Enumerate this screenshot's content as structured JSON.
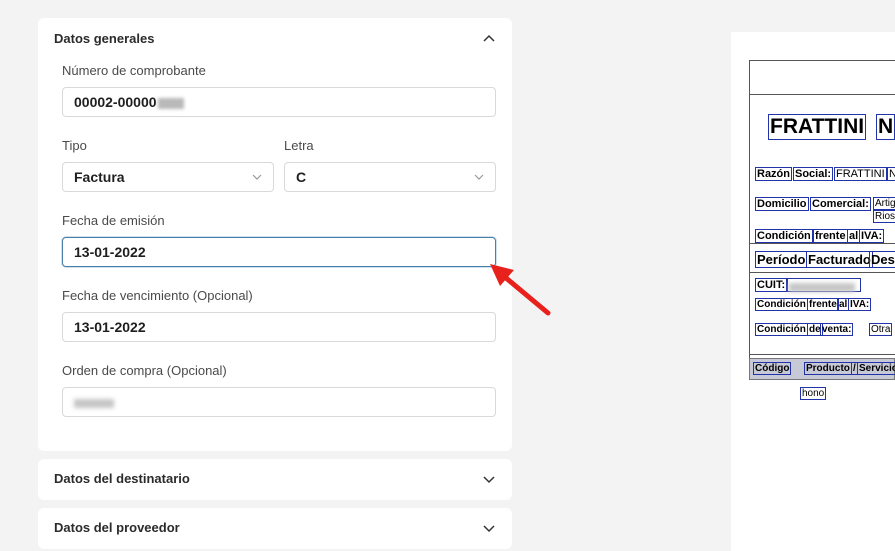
{
  "sections": {
    "general": {
      "title": "Datos generales",
      "numero_label": "Número de comprobante",
      "numero_value": "00002-00000",
      "tipo_label": "Tipo",
      "tipo_value": "Factura",
      "letra_label": "Letra",
      "letra_value": "C",
      "fecha_emision_label": "Fecha de emisión",
      "fecha_emision_value": "13-01-2022",
      "fecha_venc_label": "Fecha de vencimiento (Opcional)",
      "fecha_venc_value": "13-01-2022",
      "orden_label": "Orden de compra (Opcional)",
      "orden_value": ""
    },
    "destinatario": {
      "title": "Datos del destinatario"
    },
    "proveedor": {
      "title": "Datos del proveedor"
    }
  },
  "icons": {
    "collapse": "chevron-up-icon",
    "expand": "chevron-down-icon",
    "select": "chevron-down-icon",
    "pointer": "red-arrow-icon"
  },
  "colors": {
    "focus_border": "#4a7fa8",
    "arrow": "#e8211d",
    "doc_box": "#2233aa"
  },
  "preview": {
    "company": "FRATTINI",
    "company_tail": "N",
    "razon_label": [
      "Razón",
      "Social:"
    ],
    "razon_value": "FRATTINI",
    "razon_tail": "N",
    "domicilio_label": [
      "Domicilio",
      "Comercial:"
    ],
    "domicilio_value_1": "Artig",
    "domicilio_value_2": "Rios",
    "condicion_iva_label": [
      "Condición",
      "frente",
      "al",
      "IVA:"
    ],
    "periodo": [
      "Período",
      "Facturado",
      "Desd"
    ],
    "cuit_label": "CUIT:",
    "cond_iva2": [
      "Condición",
      "frente",
      "al",
      "IVA:"
    ],
    "cond_venta": [
      "Condición",
      "de",
      "venta:"
    ],
    "cond_venta_value": "Otra",
    "table_headers": [
      "Código",
      "Producto",
      "/",
      "Servicio"
    ],
    "item": "hono"
  }
}
